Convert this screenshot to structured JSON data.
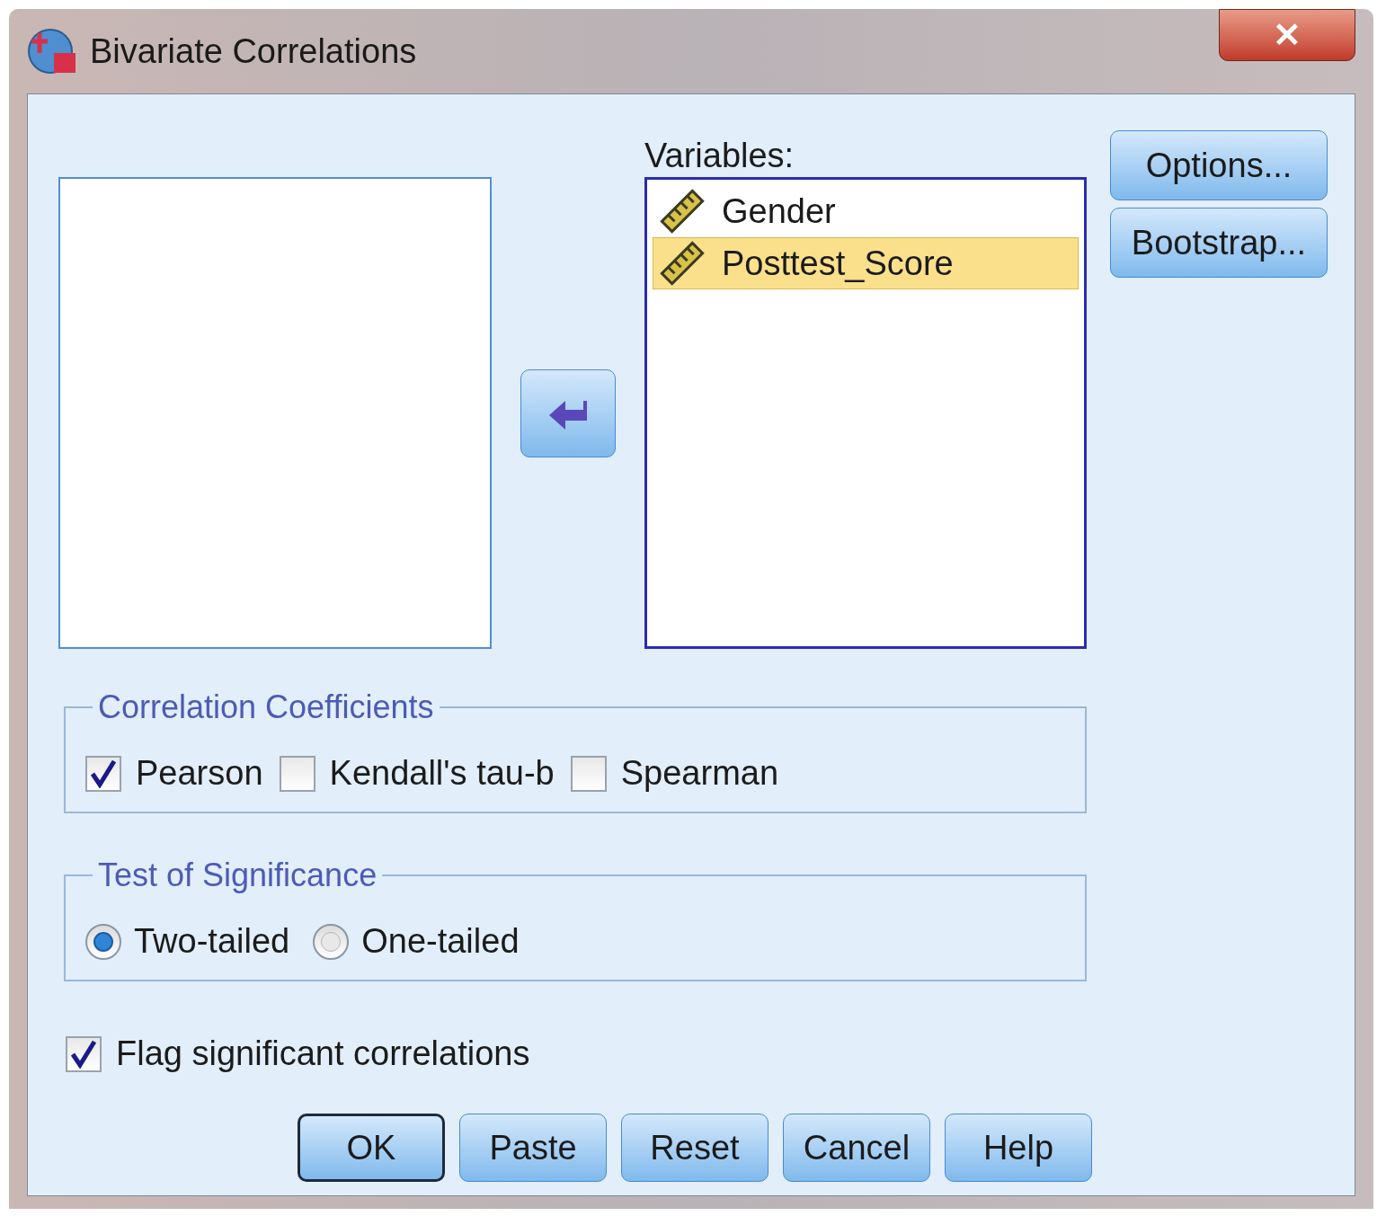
{
  "window": {
    "title": "Bivariate Correlations",
    "close": "✕"
  },
  "variables": {
    "label": "Variables:",
    "items": [
      {
        "name": "Gender",
        "selected": false
      },
      {
        "name": "Posttest_Score",
        "selected": true
      }
    ]
  },
  "side_buttons": [
    {
      "label": "Options..."
    },
    {
      "label": "Bootstrap..."
    }
  ],
  "correlation_coefficients": {
    "title": "Correlation Coefficients",
    "options": [
      {
        "label": "Pearson",
        "checked": true
      },
      {
        "label": "Kendall's tau-b",
        "checked": false
      },
      {
        "label": "Spearman",
        "checked": false
      }
    ]
  },
  "test_of_significance": {
    "title": "Test of Significance",
    "options": [
      {
        "label": "Two-tailed",
        "selected": true
      },
      {
        "label": "One-tailed",
        "selected": false
      }
    ]
  },
  "flag_significant": {
    "label": "Flag significant correlations",
    "checked": true
  },
  "buttons": [
    {
      "label": "OK",
      "default": true
    },
    {
      "label": "Paste",
      "default": false
    },
    {
      "label": "Reset",
      "default": false
    },
    {
      "label": "Cancel",
      "default": false
    },
    {
      "label": "Help",
      "default": false
    }
  ]
}
